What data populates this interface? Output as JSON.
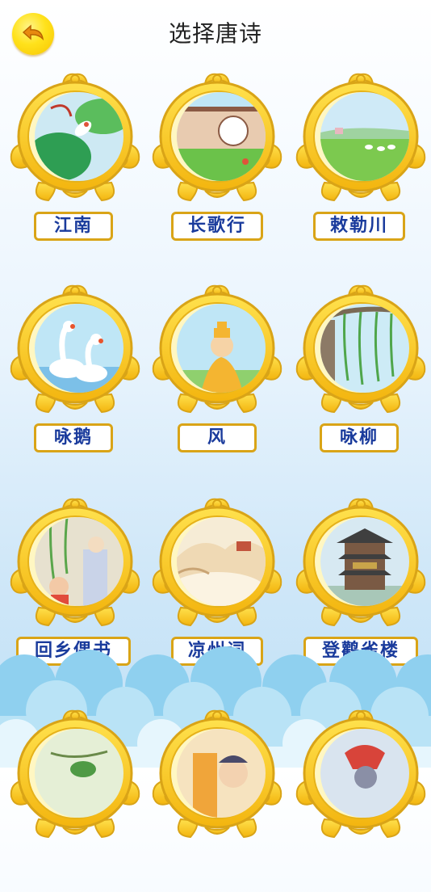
{
  "header": {
    "title": "选择唐诗",
    "back_icon": "back-arrow-icon"
  },
  "poems": [
    {
      "title": "江南"
    },
    {
      "title": "长歌行"
    },
    {
      "title": "敕勒川"
    },
    {
      "title": "咏鹅"
    },
    {
      "title": "风"
    },
    {
      "title": "咏柳"
    },
    {
      "title": "回乡偶书"
    },
    {
      "title": "凉州词"
    },
    {
      "title": "登鹳雀楼"
    }
  ],
  "colors": {
    "frame": "#f7c51c",
    "frame_border": "#d9a417",
    "label_text": "#1a3b9c",
    "back_button": "#ffe21c"
  }
}
